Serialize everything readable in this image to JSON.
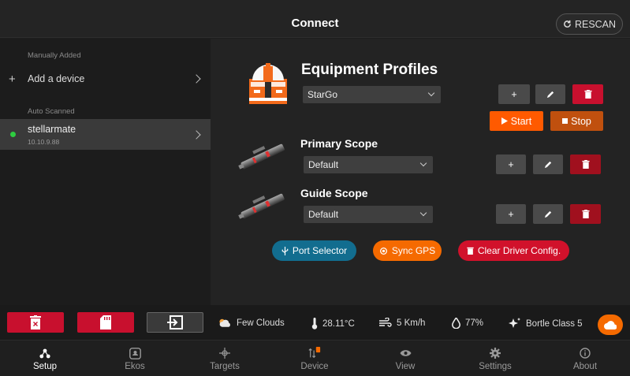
{
  "header": {
    "title": "Connect",
    "rescan_label": "RESCAN"
  },
  "sidebar": {
    "manual_label": "Manually Added",
    "add_device_label": "Add a device",
    "auto_label": "Auto Scanned",
    "devices": [
      {
        "name": "stellarmate",
        "ip": "10.10.9.88",
        "status_color": "#2ecc40"
      }
    ]
  },
  "equipment": {
    "title": "Equipment Profiles",
    "profile_value": "StarGo",
    "start_label": "Start",
    "stop_label": "Stop"
  },
  "primary_scope": {
    "title": "Primary Scope",
    "value": "Default"
  },
  "guide_scope": {
    "title": "Guide Scope",
    "value": "Default"
  },
  "actions": {
    "port_selector": "Port Selector",
    "sync_gps": "Sync GPS",
    "clear_driver": "Clear Driver Config."
  },
  "weather": {
    "clouds": "Few Clouds",
    "temperature": "28.11°C",
    "wind": "5 Km/h",
    "humidity": "77%",
    "bortle": "Bortle Class 5"
  },
  "nav": {
    "items": [
      {
        "label": "Setup",
        "icon": "setup-icon",
        "active": true
      },
      {
        "label": "Ekos",
        "icon": "ekos-icon",
        "active": false
      },
      {
        "label": "Targets",
        "icon": "targets-icon",
        "active": false
      },
      {
        "label": "Device",
        "icon": "device-icon",
        "active": false
      },
      {
        "label": "View",
        "icon": "eye-icon",
        "active": false
      },
      {
        "label": "Settings",
        "icon": "gear-icon",
        "active": false
      },
      {
        "label": "About",
        "icon": "info-icon",
        "active": false
      }
    ]
  },
  "colors": {
    "accent_orange": "#ff5a00",
    "danger_red": "#c8102e",
    "port_blue": "#126d8f"
  }
}
